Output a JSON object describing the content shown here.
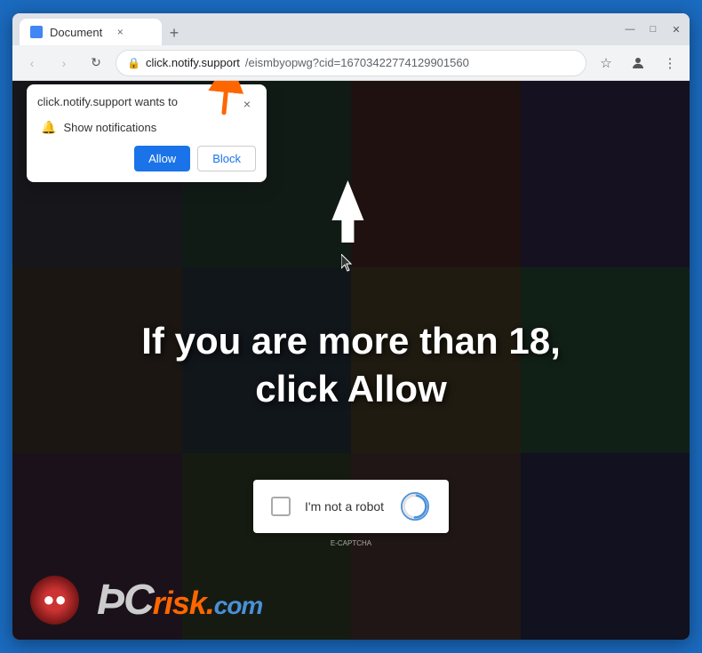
{
  "browser": {
    "tab": {
      "favicon_label": "Document favicon",
      "title": "Document",
      "close_label": "×"
    },
    "new_tab_label": "+",
    "window_controls": {
      "minimize": "—",
      "maximize": "□",
      "close": "✕"
    },
    "nav": {
      "back": "‹",
      "forward": "›",
      "refresh": "↻"
    },
    "url": {
      "lock": "🔒",
      "domain": "click.notify.support",
      "path": "/eismbyopwg?cid=16703422774129901560"
    },
    "toolbar": {
      "star": "☆",
      "account": "👤",
      "menu": "⋮"
    }
  },
  "notification_popup": {
    "title": "click.notify.support wants to",
    "close_label": "×",
    "notification_row": "Show notifications",
    "allow_label": "Allow",
    "block_label": "Block"
  },
  "webpage": {
    "main_text_line1": "If you are more than 18,",
    "main_text_line2": "click Allow",
    "captcha_label": "I'm not a robot",
    "captcha_sub": "E-CAPTCHA"
  },
  "brand": {
    "name_pc": "ÞC",
    "name_risk": "risk.",
    "name_com": "com"
  },
  "colors": {
    "browser_border": "#1a6abf",
    "allow_btn": "#1a73e8",
    "orange_arrow": "#ff6600",
    "brand_risk": "#ff6600"
  }
}
